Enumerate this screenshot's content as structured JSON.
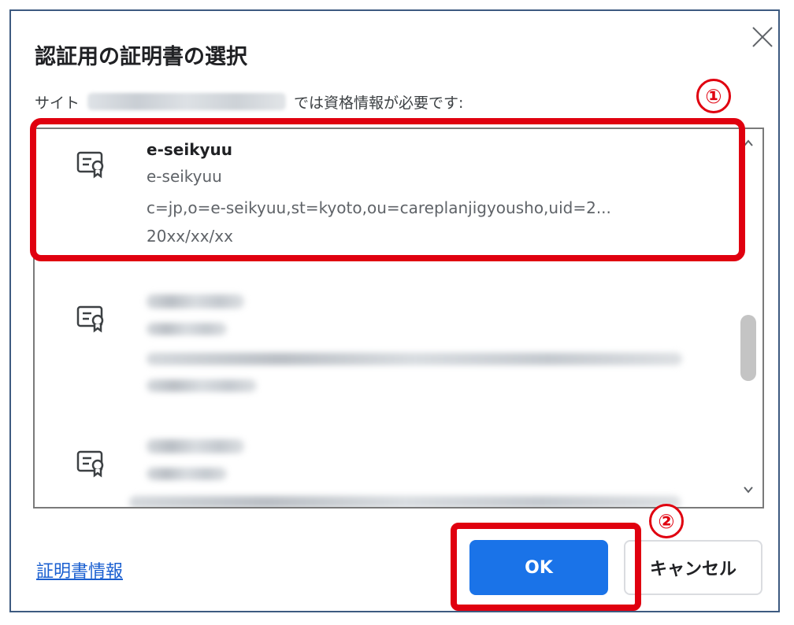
{
  "dialog": {
    "title": "認証用の証明書の選択",
    "close_icon": "close-icon",
    "subtitle_prefix": "サイト",
    "subtitle_suffix": "では資格情報が必要です:"
  },
  "certificates": [
    {
      "name": "e-seikyuu",
      "issuer": "e-seikyuu",
      "subject": "c=jp,o=e-seikyuu,st=kyoto,ou=careplanjigyousho,uid=2...",
      "date": "20xx/xx/xx",
      "icon": "certificate-icon"
    },
    {
      "icon": "certificate-icon"
    },
    {
      "icon": "certificate-icon"
    }
  ],
  "annotations": {
    "marker1": "①",
    "marker2": "②",
    "highlight_color": "#e0000f"
  },
  "footer": {
    "cert_info_link": "証明書情報",
    "ok_label": "OK",
    "cancel_label": "キャンセル"
  },
  "colors": {
    "primary_button": "#1a73e8",
    "link": "#1a5fd0",
    "frame_border": "#3d5a80"
  }
}
